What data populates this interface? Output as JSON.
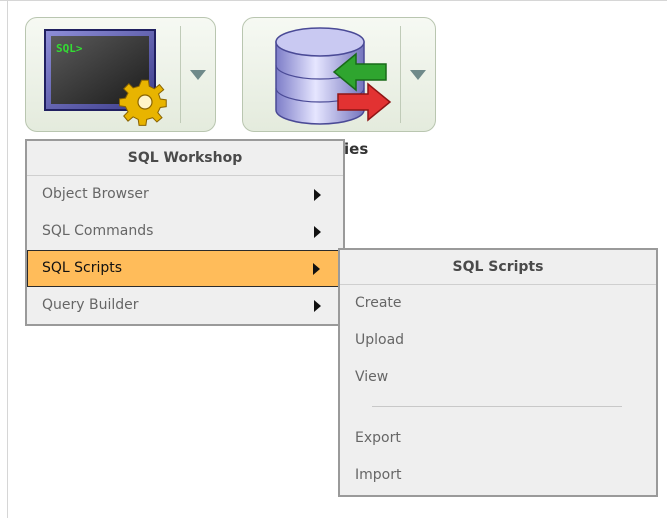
{
  "tiles": {
    "workshop": {
      "icon": "sql-workshop-icon",
      "screen_text": "SQL>",
      "dropdown_icon": "chevron-down-icon"
    },
    "utilities": {
      "icon": "database-arrows-icon",
      "caption_suffix": "ies",
      "dropdown_icon": "chevron-down-icon"
    }
  },
  "main_menu": {
    "title": "SQL Workshop",
    "items": [
      {
        "label": "Object Browser",
        "has_submenu": true
      },
      {
        "label": "SQL Commands",
        "has_submenu": true
      },
      {
        "label": "SQL Scripts",
        "has_submenu": true,
        "selected": true
      },
      {
        "label": "Query Builder",
        "has_submenu": true
      }
    ]
  },
  "sub_menu": {
    "title": "SQL Scripts",
    "items": [
      {
        "label": "Create"
      },
      {
        "label": "Upload"
      },
      {
        "label": "View"
      },
      {
        "label": "Export"
      },
      {
        "label": "Import"
      }
    ]
  },
  "colors": {
    "selected_bg": "#ffbc5a",
    "menu_bg": "#efefef",
    "menu_border": "#9a9a9a",
    "tile_border": "#b9c6b0"
  }
}
